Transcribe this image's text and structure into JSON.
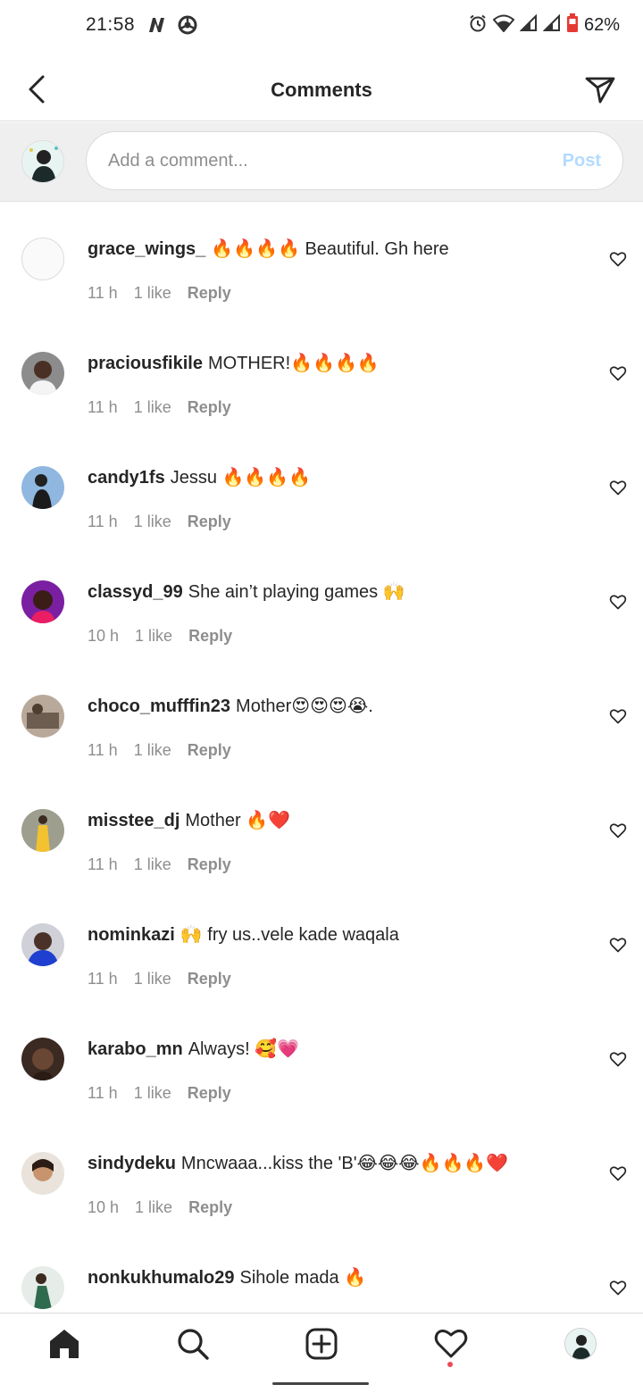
{
  "status_bar": {
    "time": "21:58",
    "battery": "62%",
    "icons": [
      "netflix-n-icon",
      "chrome-icon",
      "alarm-icon",
      "wifi-icon",
      "signal-icon",
      "signal-icon",
      "battery-low-icon"
    ]
  },
  "header": {
    "title": "Comments",
    "back_icon": "chevron-left-icon",
    "send_icon": "paper-plane-icon"
  },
  "composer": {
    "placeholder": "Add a comment...",
    "post_label": "Post",
    "post_color": "#b3dbff"
  },
  "comments": [
    {
      "username": "grace_wings_",
      "text": "🔥🔥🔥🔥 Beautiful. Gh here",
      "time": "11 h",
      "likes": "1 like",
      "reply": "Reply",
      "avatar_color": "#f5f5f5"
    },
    {
      "username": "praciousfikile",
      "text": "MOTHER!🔥🔥🔥🔥",
      "time": "11 h",
      "likes": "1 like",
      "reply": "Reply",
      "avatar_color": "#6b4a3a"
    },
    {
      "username": "candy1fs",
      "text": "Jessu 🔥🔥🔥🔥",
      "time": "11 h",
      "likes": "1 like",
      "reply": "Reply",
      "avatar_color": "#4f7fb8"
    },
    {
      "username": "classyd_99",
      "text": "She ain’t playing games 🙌",
      "time": "10 h",
      "likes": "1 like",
      "reply": "Reply",
      "avatar_color": "#8b2a9e"
    },
    {
      "username": "choco_mufffin23",
      "text": "Mother😍😍😍😭.",
      "time": "11 h",
      "likes": "1 like",
      "reply": "Reply",
      "avatar_color": "#7a6a5e"
    },
    {
      "username": "misstee_dj",
      "text": "Mother 🔥❤️",
      "time": "11 h",
      "likes": "1 like",
      "reply": "Reply",
      "avatar_color": "#c9a23a"
    },
    {
      "username": "nominkazi",
      "text": "🙌 fry us..vele kade waqala",
      "time": "11 h",
      "likes": "1 like",
      "reply": "Reply",
      "avatar_color": "#2c3fa8"
    },
    {
      "username": "karabo_mn",
      "text": "Always! 🥰💗",
      "time": "11 h",
      "likes": "1 like",
      "reply": "Reply",
      "avatar_color": "#5a3a2c"
    },
    {
      "username": "sindydeku",
      "text": "Mncwaaa...kiss the 'B'😂😂😂🔥🔥🔥❤️",
      "time": "10 h",
      "likes": "1 like",
      "reply": "Reply",
      "avatar_color": "#c8a07a"
    },
    {
      "username": "nonkukhumalo29",
      "text": "Sihole mada 🔥",
      "time": "",
      "likes": "",
      "reply": "",
      "avatar_color": "#3f6b55"
    }
  ],
  "bottom_nav": {
    "items": [
      "home-icon",
      "search-icon",
      "new-post-icon",
      "activity-heart-icon",
      "profile-avatar"
    ],
    "notification_dot_color": "#ed4956"
  }
}
